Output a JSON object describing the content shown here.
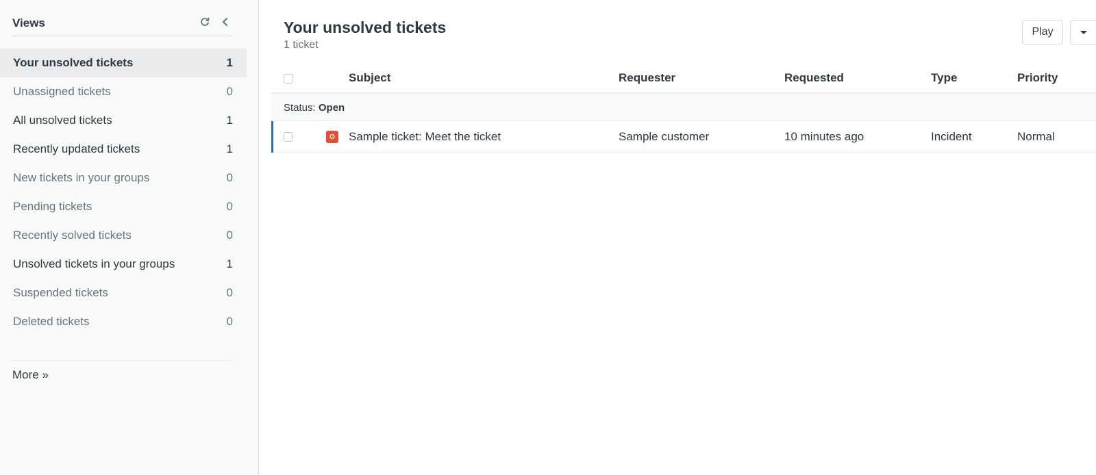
{
  "sidebar": {
    "title": "Views",
    "refresh_icon": "refresh-icon",
    "collapse_icon": "chevron-left-icon",
    "items": [
      {
        "label": "Your unsolved tickets",
        "count": "1",
        "state": "selected"
      },
      {
        "label": "Unassigned tickets",
        "count": "0",
        "state": "empty"
      },
      {
        "label": "All unsolved tickets",
        "count": "1",
        "state": "active"
      },
      {
        "label": "Recently updated tickets",
        "count": "1",
        "state": "active"
      },
      {
        "label": "New tickets in your groups",
        "count": "0",
        "state": "empty"
      },
      {
        "label": "Pending tickets",
        "count": "0",
        "state": "empty"
      },
      {
        "label": "Recently solved tickets",
        "count": "0",
        "state": "empty"
      },
      {
        "label": "Unsolved tickets in your groups",
        "count": "1",
        "state": "active"
      },
      {
        "label": "Suspended tickets",
        "count": "0",
        "state": "empty"
      },
      {
        "label": "Deleted tickets",
        "count": "0",
        "state": "empty"
      }
    ],
    "more_label": "More »"
  },
  "main": {
    "title": "Your unsolved tickets",
    "subtitle": "1 ticket",
    "play_label": "Play",
    "dropdown_icon": "caret-down-icon"
  },
  "table": {
    "columns": [
      "Subject",
      "Requester",
      "Requested",
      "Type",
      "Priority"
    ],
    "group": {
      "prefix": "Status:",
      "value": "Open"
    },
    "rows": [
      {
        "status_badge": "O",
        "subject": "Sample ticket: Meet the ticket",
        "requester": "Sample customer",
        "requested": "10 minutes ago",
        "type": "Incident",
        "priority": "Normal"
      }
    ]
  },
  "colors": {
    "accent": "#1f73b7",
    "status_open": "#e34f32"
  }
}
